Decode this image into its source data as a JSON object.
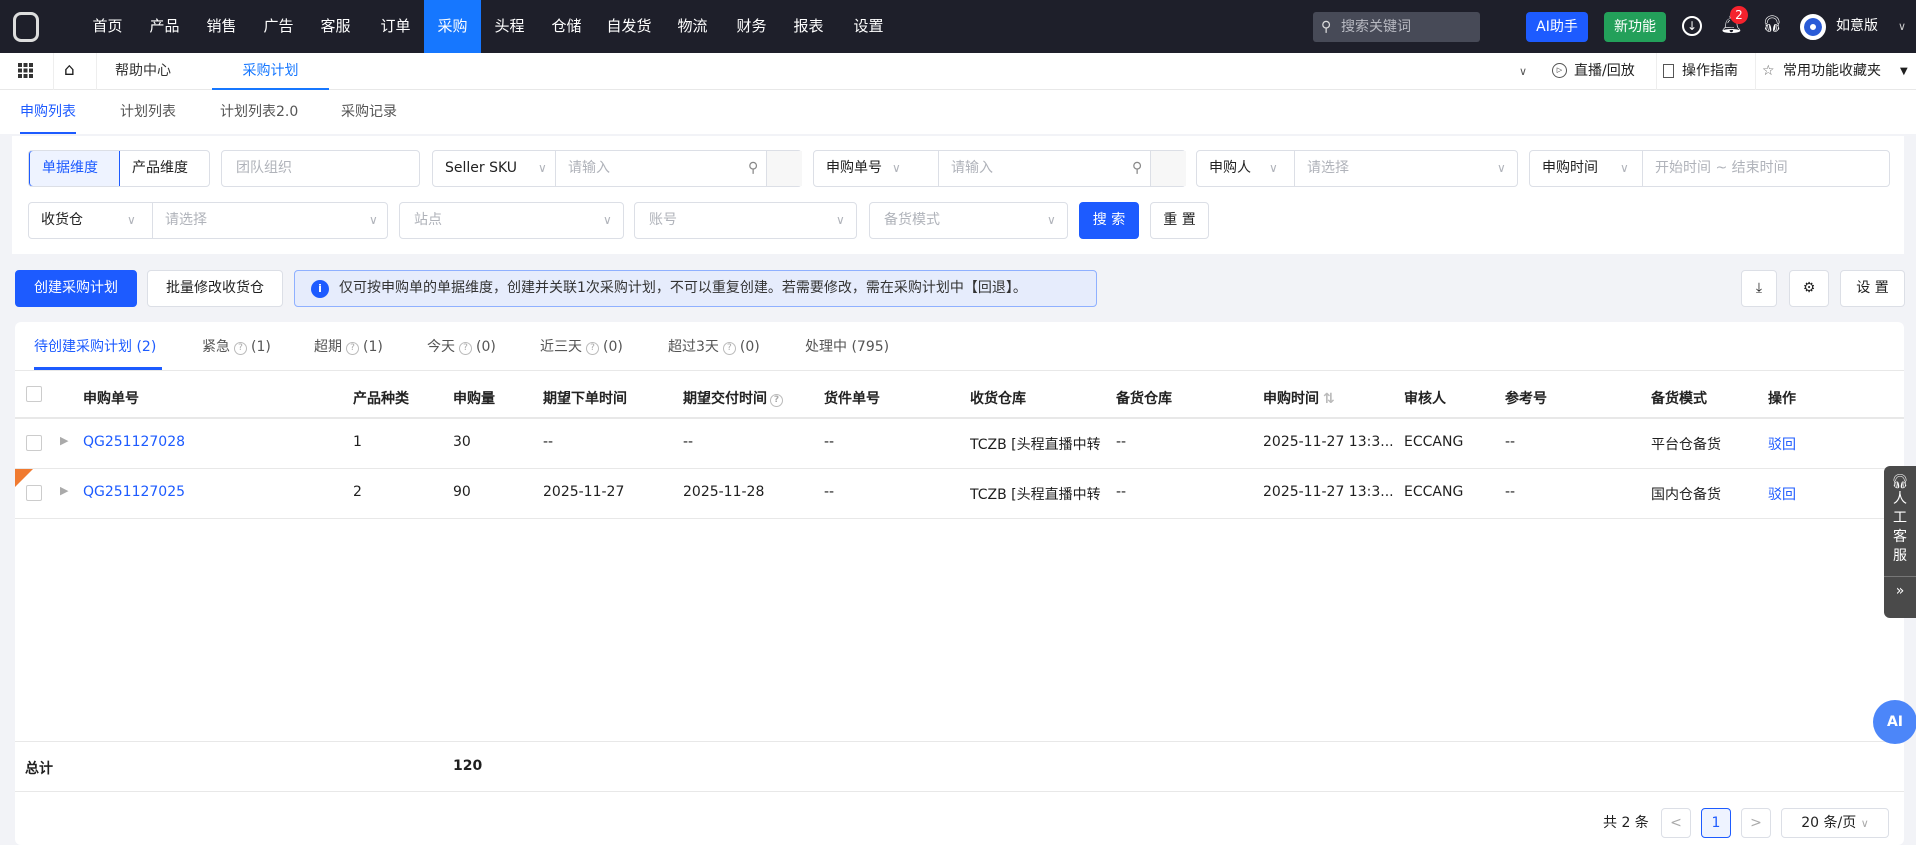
{
  "topnav": {
    "items": [
      "首页",
      "产品",
      "销售",
      "广告",
      "客服",
      "订单",
      "采购",
      "头程",
      "仓储",
      "自发货",
      "物流",
      "财务",
      "报表",
      "设置"
    ],
    "active": 6,
    "search_placeholder": "搜索关键词",
    "ai_button": "AI助手",
    "new_button": "新功能",
    "notification_count": "2",
    "user": "如意版",
    "active_color": "#1677ff"
  },
  "tabbar": {
    "tabs": [
      "帮助中心",
      "采购计划"
    ],
    "active": 1,
    "live": "直播/回放",
    "guide": "操作指南",
    "favorites": "常用功能收藏夹"
  },
  "subtabs": {
    "items": [
      "申购列表",
      "计划列表",
      "计划列表2.0",
      "采购记录"
    ],
    "active": 0
  },
  "filters": {
    "dim_doc": "单据维度",
    "dim_product": "产品维度",
    "team_placeholder": "团队组织",
    "sku_select": "Seller SKU",
    "sku_placeholder": "请输入",
    "order_select": "申购单号",
    "order_placeholder": "请输入",
    "applicant_select": "申购人",
    "applicant_placeholder": "请选择",
    "time_select": "申购时间",
    "time_placeholder": "开始时间 ~ 结束时间",
    "warehouse_select": "收货仓",
    "warehouse_placeholder": "请选择",
    "site_placeholder": "站点",
    "account_placeholder": "账号",
    "mode_placeholder": "备货模式",
    "search": "搜 索",
    "reset": "重 置"
  },
  "actions": {
    "create": "创建采购计划",
    "batch": "批量修改收货仓",
    "info": "仅可按申购单的单据维度，创建并关联1次采购计划，不可以重复创建。若需要修改，需在采购计划中【回退】。",
    "settings": "设 置"
  },
  "status_tabs": [
    {
      "label": "待创建采购计划 (2)"
    },
    {
      "label": "紧急",
      "count": "(1)"
    },
    {
      "label": "超期",
      "count": "(1)"
    },
    {
      "label": "今天",
      "count": "(0)"
    },
    {
      "label": "近三天",
      "count": "(0)"
    },
    {
      "label": "超过3天",
      "count": "(0)"
    },
    {
      "label": "处理中 (795)"
    }
  ],
  "table": {
    "headers": [
      "申购单号",
      "产品种类",
      "申购量",
      "期望下单时间",
      "期望交付时间",
      "货件单号",
      "收货仓库",
      "备货仓库",
      "申购时间",
      "审核人",
      "参考号",
      "备货模式",
      "操作"
    ],
    "rows": [
      [
        "QG251127028",
        "1",
        "30",
        "--",
        "--",
        "--",
        "TCZB [头程直播中转",
        "--",
        "2025-11-27 13:3...",
        "ECCANG",
        "--",
        "平台仓备货",
        "驳回"
      ],
      [
        "QG251127025",
        "2",
        "90",
        "2025-11-27",
        "2025-11-28",
        "--",
        "TCZB [头程直播中转",
        "--",
        "2025-11-27 13:3...",
        "ECCANG",
        "--",
        "国内仓备货",
        "驳回"
      ]
    ],
    "total_label": "总计",
    "total_qty": "120"
  },
  "pagination": {
    "total": "共 2 条",
    "page": "1",
    "page_size": "20 条/页"
  },
  "side": {
    "service": [
      "人",
      "工",
      "客",
      "服"
    ],
    "collapse": "»",
    "ai": "AI"
  }
}
